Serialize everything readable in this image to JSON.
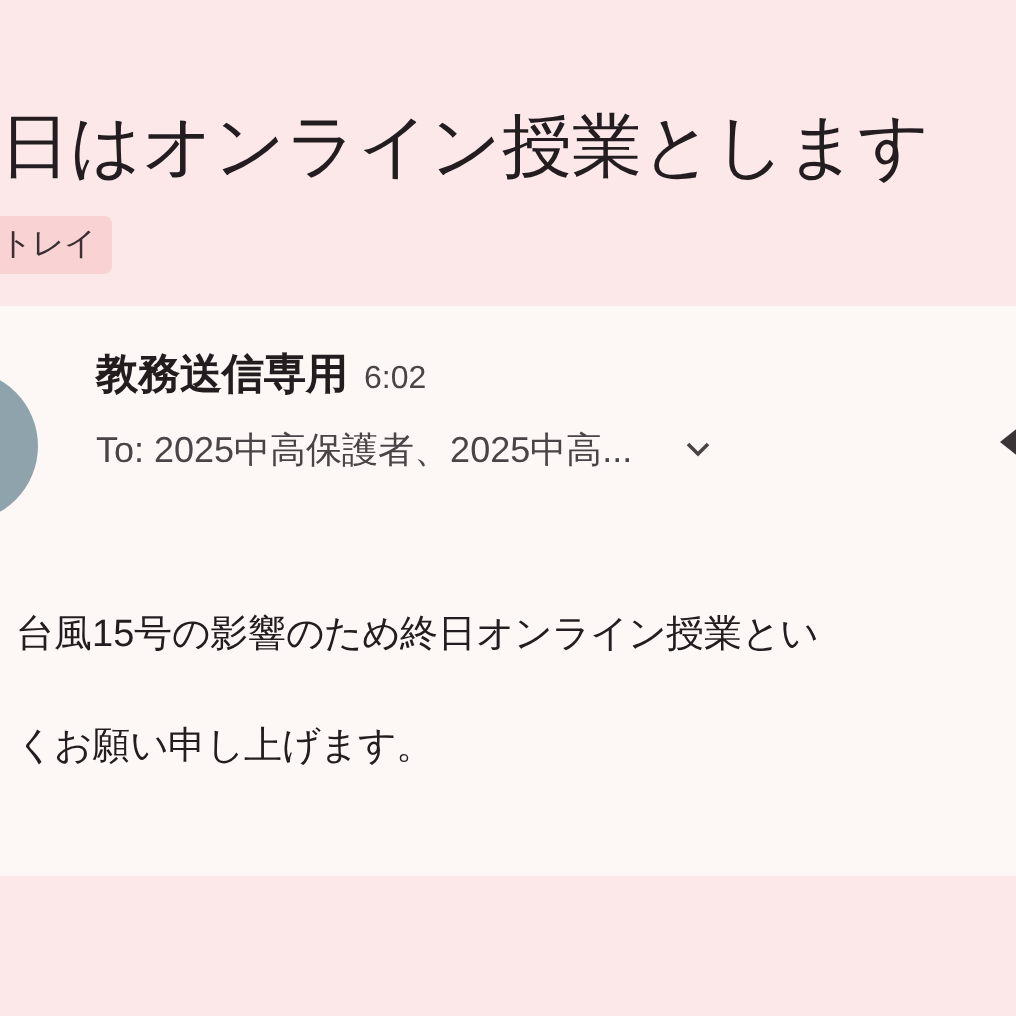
{
  "subject": "日はオンライン授業とします",
  "label": "トレイ",
  "message": {
    "sender": "教務送信専用",
    "time": "6:02",
    "recipients": "To: 2025中高保護者、2025中高...",
    "body": [
      "台風15号の影響のため終日オンライン授業とい",
      "くお願い申し上げます。"
    ]
  }
}
